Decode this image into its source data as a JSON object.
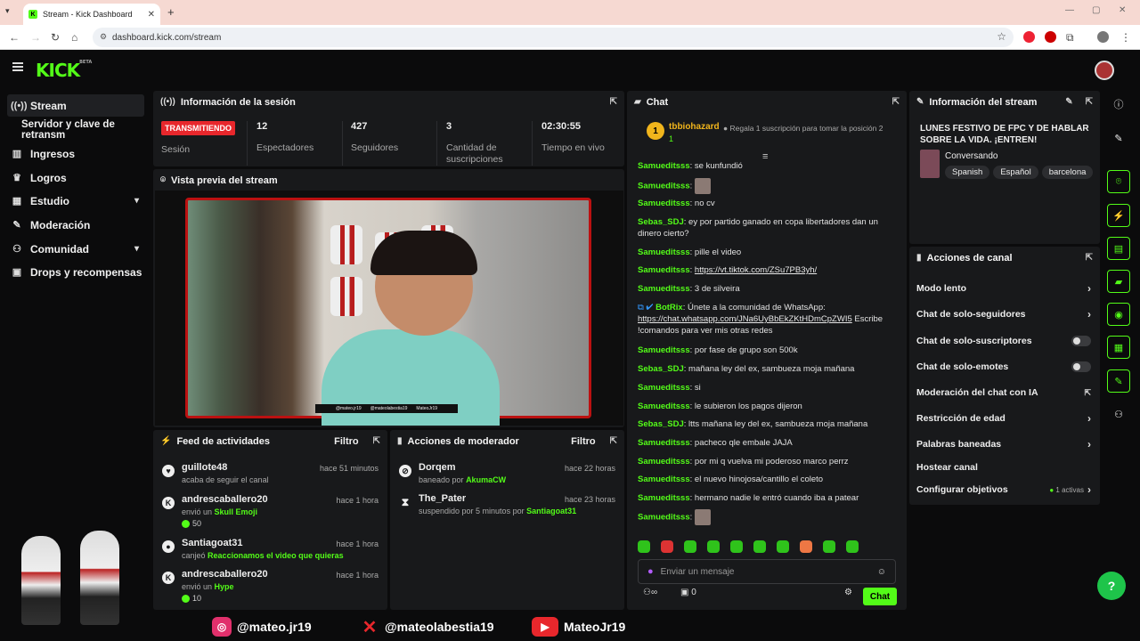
{
  "browser": {
    "tab_title": "Stream - Kick Dashboard",
    "url": "dashboard.kick.com/stream"
  },
  "kick": {
    "logo": "KICK",
    "logo_sup": "BETA"
  },
  "leftnav": {
    "items": [
      {
        "label": "Stream",
        "icon": "broadcast-icon"
      },
      {
        "label": "Servidor y clave de retransm",
        "icon": ""
      },
      {
        "label": "Ingresos",
        "icon": "chart-icon"
      },
      {
        "label": "Logros",
        "icon": "trophy-icon"
      },
      {
        "label": "Estudio",
        "icon": "studio-icon"
      },
      {
        "label": "Moderación",
        "icon": "wrench-icon"
      },
      {
        "label": "Comunidad",
        "icon": "community-icon"
      },
      {
        "label": "Drops y recompensas",
        "icon": "gift-icon"
      }
    ]
  },
  "session": {
    "title": "Información de la sesión",
    "live_badge": "TRANSMITIENDO",
    "session_label": "Sesión",
    "stats": [
      {
        "value": "12",
        "label": "Espectadores"
      },
      {
        "value": "427",
        "label": "Seguidores"
      },
      {
        "value": "3",
        "label": "Cantidad de suscripciones"
      },
      {
        "value": "02:30:55",
        "label": "Tiempo en vivo"
      }
    ]
  },
  "preview": {
    "title": "Vista previa del stream",
    "overlay": [
      "@mateo.jr19",
      "@mateolabestia19",
      "MateoJr19"
    ]
  },
  "feed": {
    "title": "Feed de actividades",
    "filter": "Filtro",
    "items": [
      {
        "name": "guillote48",
        "desc": "acaba de seguir el canal",
        "highlight": "",
        "time": "hace 51 minutos",
        "points": ""
      },
      {
        "name": "andrescaballero20",
        "desc": "envió un",
        "highlight": "Skull Emoji",
        "time": "hace 1 hora",
        "points": "50"
      },
      {
        "name": "Santiagoat31",
        "desc": "canjeó",
        "highlight": "Reaccionamos el video que quieras",
        "time": "hace 1 hora",
        "points": ""
      },
      {
        "name": "andrescaballero20",
        "desc": "envió un",
        "highlight": "Hype",
        "time": "hace 1 hora",
        "points": "10"
      }
    ]
  },
  "modactions": {
    "title": "Acciones de moderador",
    "filter": "Filtro",
    "items": [
      {
        "name": "Dorqem",
        "desc": "baneado por",
        "highlight": "AkumaCW",
        "time": "hace 22 horas"
      },
      {
        "name": "The_Pater",
        "desc": "suspendido por 5 minutos por",
        "highlight": "Santiagoat31",
        "time": "hace 23 horas"
      }
    ]
  },
  "chat": {
    "title": "Chat",
    "pinned_user": "tbbiohazard",
    "pinned_count": "1",
    "pinned_badge": "1",
    "gift_text": "Regala 1 suscripción para tomar la posición 2",
    "messages": [
      {
        "user": "Samueditsss",
        "text": "se kunfundió"
      },
      {
        "user": "Samueditsss",
        "text": ""
      },
      {
        "user": "Samueditsss",
        "text": "no cv"
      },
      {
        "user": "Sebas_SDJ",
        "text": "ey por partido ganado en copa libertadores dan un dinero cierto?"
      },
      {
        "user": "Samueditsss",
        "text": "pille el video"
      },
      {
        "user": "Samueditsss",
        "text": "https://vt.tiktok.com/ZSu7PB3yh/"
      },
      {
        "user": "Samueditsss",
        "text": "3 de silveira"
      },
      {
        "user": "BotRix",
        "text": "Únete a la comunidad de WhatsApp:",
        "link": "https://chat.whatsapp.com/JNa6UyBbEkZKtHDmCpZWI5",
        "after": "Escribe !comandos para ver mis otras redes"
      },
      {
        "user": "Samueditsss",
        "text": "por fase de grupo son 500k"
      },
      {
        "user": "Sebas_SDJ",
        "text": "mañana ley del ex, sambueza moja mañana"
      },
      {
        "user": "Samueditsss",
        "text": "si"
      },
      {
        "user": "Samueditsss",
        "text": "le subieron los pagos dijeron"
      },
      {
        "user": "Sebas_SDJ",
        "text": "ltts mañana ley del ex, sambueza moja mañana"
      },
      {
        "user": "Samueditsss",
        "text": "pacheco qle embale JAJA"
      },
      {
        "user": "Samueditsss",
        "text": "por mi q vuelva mi poderoso marco perrz"
      },
      {
        "user": "Samueditsss",
        "text": "el nuevo hinojosa/cantillo el coleto"
      },
      {
        "user": "Samueditsss",
        "text": "hermano nadie le entró cuando iba a patear"
      },
      {
        "user": "Samueditsss",
        "text": ""
      }
    ],
    "input_placeholder": "Enviar un mensaje",
    "viewers_count": "0",
    "send_label": "Chat"
  },
  "streaminfo": {
    "title": "Información del stream",
    "stream_title": "LUNES FESTIVO DE FPC Y DE HABLAR SOBRE LA VIDA. ¡ENTREN!",
    "category": "Conversando",
    "tags": [
      "Spanish",
      "Español",
      "barcelona"
    ]
  },
  "channelactions": {
    "title": "Acciones de canal",
    "items": [
      {
        "label": "Modo lento",
        "kind": "arrow"
      },
      {
        "label": "Chat de solo-seguidores",
        "kind": "arrow"
      },
      {
        "label": "Chat de solo-suscriptores",
        "kind": "toggle"
      },
      {
        "label": "Chat de solo-emotes",
        "kind": "toggle"
      },
      {
        "label": "Moderación del chat con IA",
        "kind": "external"
      },
      {
        "label": "Restricción de edad",
        "kind": "arrow"
      },
      {
        "label": "Palabras baneadas",
        "kind": "arrow"
      },
      {
        "label": "Hostear canal",
        "kind": "none"
      },
      {
        "label": "Configurar objetivos",
        "kind": "goals",
        "extra": "1 activas"
      }
    ]
  },
  "social": [
    {
      "icon": "instagram-icon",
      "handle": "@mateo.jr19"
    },
    {
      "icon": "x-icon",
      "handle": "@mateolabestia19"
    },
    {
      "icon": "youtube-icon",
      "handle": "MateoJr19"
    }
  ],
  "colors": {
    "accent": "#53fc18",
    "live": "#e8272c",
    "panel": "#18191b",
    "bg": "#0b0b0c"
  }
}
